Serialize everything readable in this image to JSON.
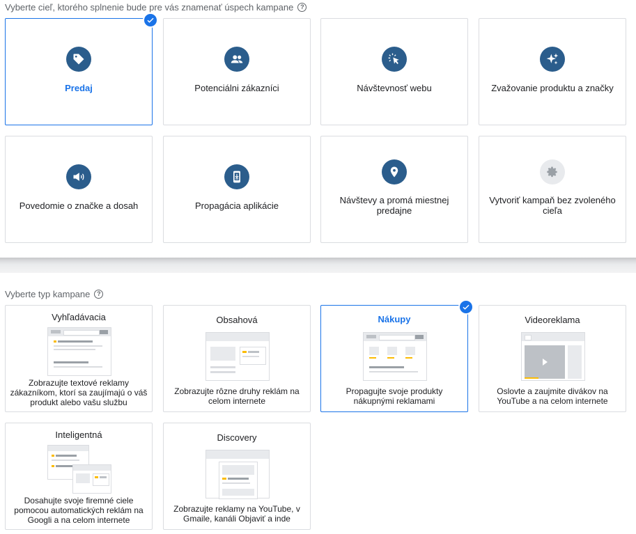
{
  "goal_section": {
    "title": "Vyberte cieľ, ktorého splnenie bude pre vás znamenať úspech kampane",
    "help_icon": "help-circle-icon",
    "goals": [
      {
        "label": "Predaj",
        "icon": "tag-icon",
        "selected": true
      },
      {
        "label": "Potenciálni zákazníci",
        "icon": "people-icon",
        "selected": false
      },
      {
        "label": "Návštevnosť webu",
        "icon": "cursor-click-icon",
        "selected": false
      },
      {
        "label": "Zvažovanie produktu a značky",
        "icon": "sparkle-icon",
        "selected": false
      },
      {
        "label": "Povedomie o značke a dosah",
        "icon": "megaphone-icon",
        "selected": false
      },
      {
        "label": "Propagácia aplikácie",
        "icon": "phone-download-icon",
        "selected": false
      },
      {
        "label": "Návštevy a promá miestnej predajne",
        "icon": "location-pin-icon",
        "selected": false
      },
      {
        "label": "Vytvoriť kampaň bez zvoleného cieľa",
        "icon": "gear-icon",
        "selected": false
      }
    ]
  },
  "type_section": {
    "title": "Vyberte typ kampane",
    "help_icon": "help-circle-icon",
    "types": [
      {
        "title": "Vyhľadávacia",
        "description": "Zobrazujte textové reklamy zákazníkom, ktorí sa zaujímajú o váš produkt alebo vašu službu",
        "selected": false
      },
      {
        "title": "Obsahová",
        "description": "Zobrazujte rôzne druhy reklám na celom internete",
        "selected": false
      },
      {
        "title": "Nákupy",
        "description": "Propagujte svoje produkty nákupnými reklamami",
        "selected": true
      },
      {
        "title": "Videoreklama",
        "description": "Oslovte a zaujmite divákov na YouTube a na celom internete",
        "selected": false
      },
      {
        "title": "Inteligentná",
        "description": "Dosahujte svoje firemné ciele pomocou automatických reklám na Googli a na celom internete",
        "selected": false
      },
      {
        "title": "Discovery",
        "description": "Zobrazujte reklamy na YouTube, v Gmaile, kanáli Objaviť a inde",
        "selected": false
      }
    ]
  },
  "colors": {
    "accent": "#1a73e8",
    "icon_circle": "#2b5d8c",
    "highlight": "#fbbc04"
  }
}
